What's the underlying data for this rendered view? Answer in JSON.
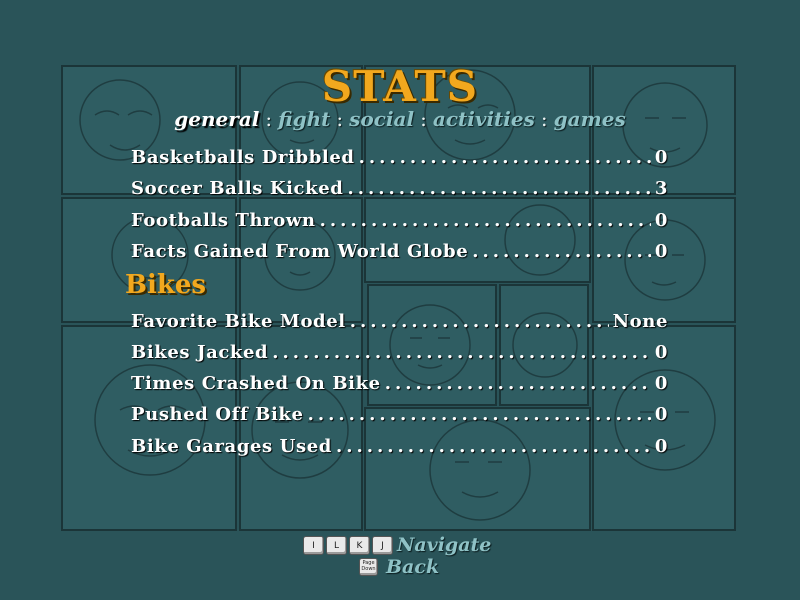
{
  "title": "STATS",
  "tabs": [
    {
      "label": "general",
      "active": true
    },
    {
      "label": "fight",
      "active": false
    },
    {
      "label": "social",
      "active": false
    },
    {
      "label": "activities",
      "active": false
    },
    {
      "label": "games",
      "active": false
    }
  ],
  "tab_separator": ":",
  "general_rows": [
    {
      "label": "Basketballs Dribbled",
      "value": "0"
    },
    {
      "label": "Soccer Balls Kicked",
      "value": "3"
    },
    {
      "label": "Footballs Thrown",
      "value": "0"
    },
    {
      "label": "Facts Gained From World Globe",
      "value": "0"
    }
  ],
  "bikes_section": {
    "heading": "Bikes",
    "rows": [
      {
        "label": "Favorite Bike Model",
        "value": "None"
      },
      {
        "label": "Bikes Jacked",
        "value": "0"
      },
      {
        "label": "Times Crashed On Bike",
        "value": "0"
      },
      {
        "label": "Pushed Off Bike",
        "value": "0"
      },
      {
        "label": "Bike Garages Used",
        "value": "0"
      }
    ]
  },
  "footer": {
    "nav_keys": [
      "I",
      "L",
      "K",
      "J"
    ],
    "navigate_label": "Navigate",
    "back_key_label": "Page Down",
    "back_label": "Back"
  },
  "colors": {
    "background": "#2a5459",
    "accent": "#f2a81e",
    "tab_inactive": "#8fc2c6",
    "text": "#ffffff"
  }
}
